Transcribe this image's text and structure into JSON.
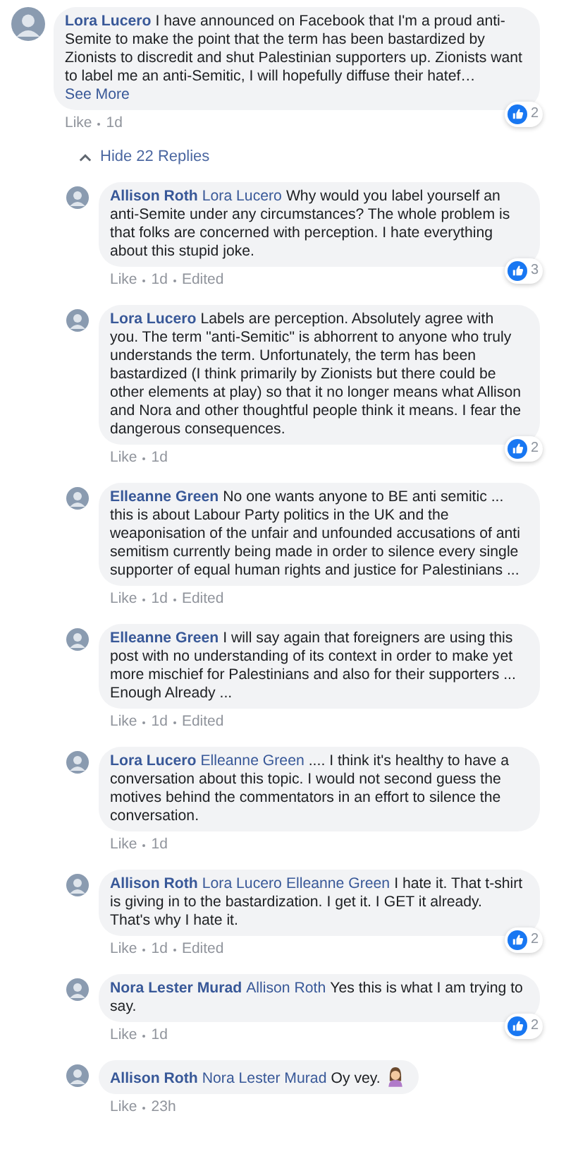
{
  "comment": {
    "author": "Lora Lucero",
    "text": "I have announced on Facebook that I'm a proud anti-Semite to make the point that the term has been bastardized by Zionists to discredit and shut Palestinian supporters up. Zionists want to label me an anti-Semitic, I will hopefully diffuse their hatef…",
    "see_more": "See More",
    "like": "Like",
    "time": "1d",
    "reactions": "2"
  },
  "replies_toggle": {
    "label": "Hide 22 Replies",
    "expanded": true
  },
  "replies": [
    {
      "author": "Allison Roth",
      "mentions": [
        "Lora Lucero"
      ],
      "text": "Why would you label yourself an anti-Semite under any circumstances? The whole problem is that folks are concerned with perception. I hate everything about this stupid joke.",
      "like": "Like",
      "time": "1d",
      "edited": "Edited",
      "reactions": "3"
    },
    {
      "author": "Lora Lucero",
      "text": "Labels are perception. Absolutely agree with you. The term \"anti-Semitic\" is abhorrent to anyone who truly understands the term. Unfortunately, the term has been bastardized (I think primarily by Zionists but there could be other elements at play) so that it no longer means what Allison and Nora and other thoughtful people think it means. I fear the dangerous consequences.",
      "like": "Like",
      "time": "1d",
      "reactions": "2"
    },
    {
      "author": "Elleanne Green",
      "text": "No one wants anyone to BE anti semitic ... this is about Labour Party politics in the UK and the weaponisation of the unfair and unfounded accusations of anti semitism currently being made in order to silence every single supporter of equal human rights and justice for Palestinians ...",
      "like": "Like",
      "time": "1d",
      "edited": "Edited"
    },
    {
      "author": "Elleanne Green",
      "text": "I will say again that foreigners are using this post with no understanding of its context in order to make yet more mischief for Palestinians and also for their supporters ... Enough Already ...",
      "like": "Like",
      "time": "1d",
      "edited": "Edited"
    },
    {
      "author": "Lora Lucero",
      "mentions": [
        "Elleanne Green"
      ],
      "text": ".... I think it's healthy to have a conversation about this topic. I would not second guess the motives behind the commentators in an effort to silence the conversation.",
      "like": "Like",
      "time": "1d"
    },
    {
      "author": "Allison Roth",
      "mentions": [
        "Lora Lucero",
        "Elleanne Green"
      ],
      "text": "I hate it. That t-shirt is giving in to the bastardization. I get it. I GET it already. That's why I hate it.",
      "like": "Like",
      "time": "1d",
      "edited": "Edited",
      "reactions": "2"
    },
    {
      "author": "Nora Lester Murad",
      "mentions": [
        "Allison Roth"
      ],
      "text": "Yes this is what I am trying to say.",
      "like": "Like",
      "time": "1d",
      "reactions": "2"
    },
    {
      "author": "Allison Roth",
      "mentions": [
        "Nora Lester Murad"
      ],
      "text": "Oy vey.",
      "emoji": true,
      "like": "Like",
      "time": "23h"
    }
  ]
}
